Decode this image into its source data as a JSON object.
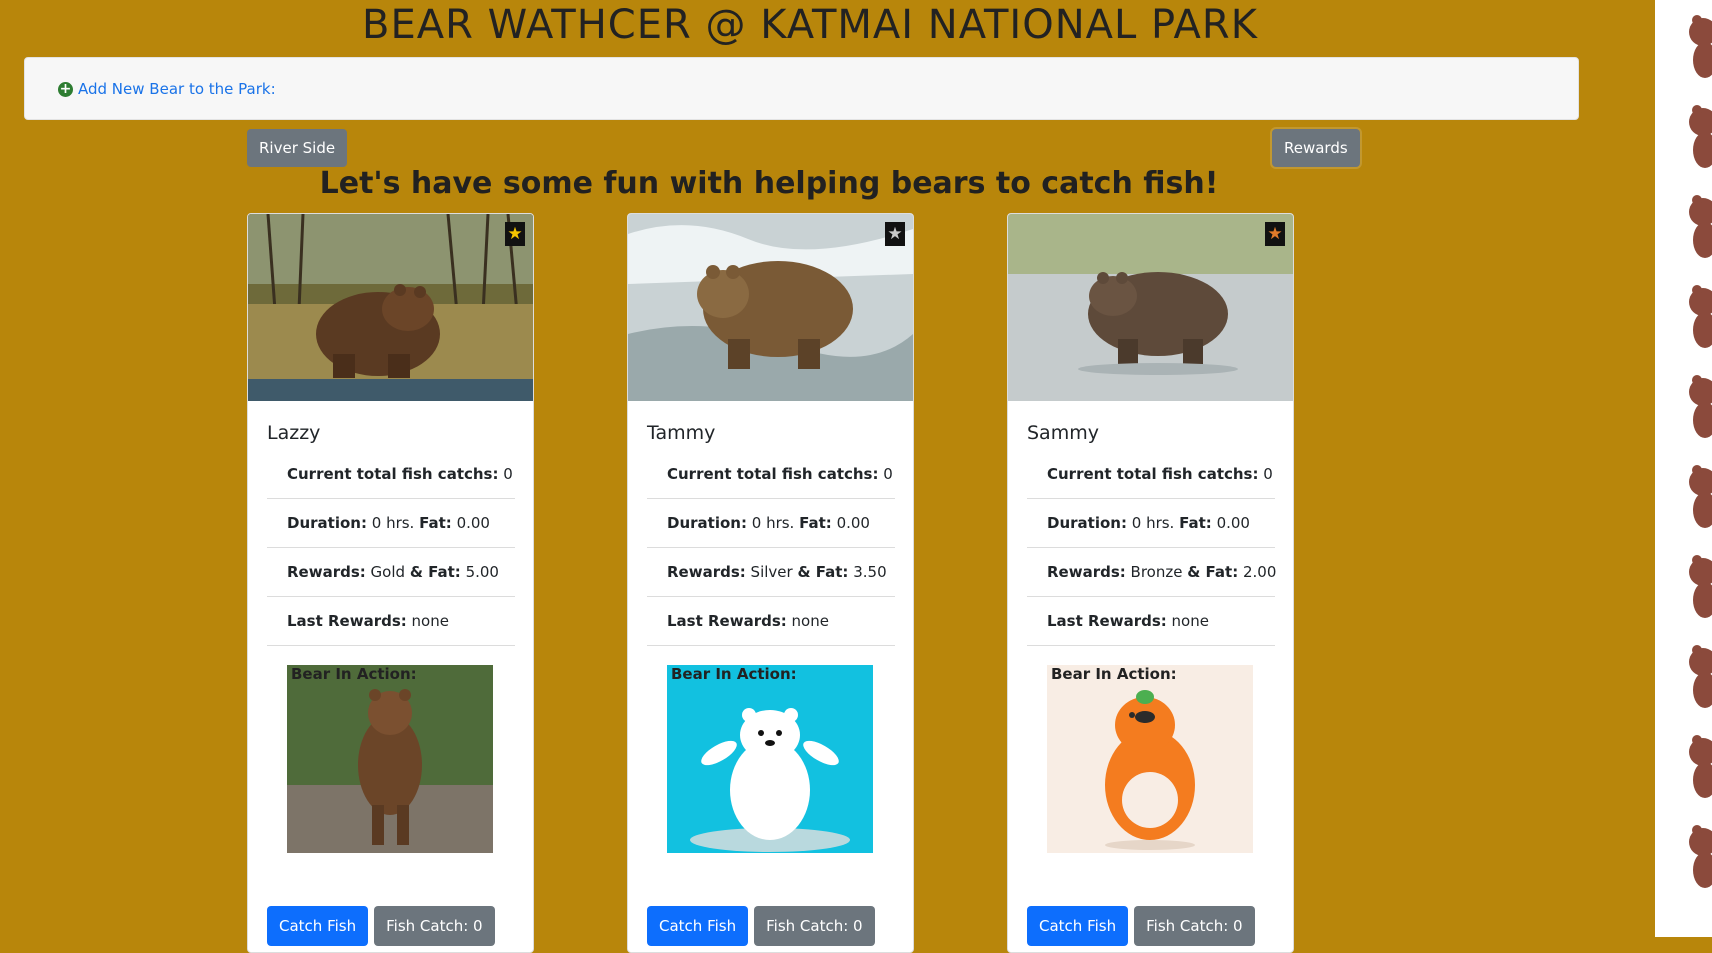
{
  "page": {
    "title": "BEAR WATHCER @ KATMAI NATIONAL PARK",
    "add_bear_label": "Add New Bear to the Park:",
    "river_side_label": "River Side",
    "rewards_label": "Rewards",
    "heading": "Let's have some fun with helping bears to catch fish!"
  },
  "labels": {
    "total_catch": "Current total fish catchs:",
    "duration": "Duration:",
    "hrs": "hrs.",
    "fat": "Fat:",
    "rewards": "Rewards:",
    "and_fat": "& Fat:",
    "last_rewards": "Last Rewards:",
    "bear_in_action": "Bear In Action:",
    "catch_fish": "Catch Fish",
    "fish_catch": "Fish Catch: 0"
  },
  "bears": [
    {
      "name": "Lazzy",
      "total_catch": "0",
      "duration": "0",
      "fat": "0.00",
      "reward": "Gold",
      "reward_fat": "5.00",
      "last_rewards": "none",
      "star_color": "#f5c400",
      "star_icon": "gold-star-icon"
    },
    {
      "name": "Tammy",
      "total_catch": "0",
      "duration": "0",
      "fat": "0.00",
      "reward": "Silver",
      "reward_fat": "3.50",
      "last_rewards": "none",
      "star_color": "#c8c8c8",
      "star_icon": "silver-star-icon"
    },
    {
      "name": "Sammy",
      "total_catch": "0",
      "duration": "0",
      "fat": "0.00",
      "reward": "Bronze",
      "reward_fat": "2.00",
      "last_rewards": "none",
      "star_color": "#e07a2a",
      "star_icon": "bronze-star-icon"
    }
  ],
  "colors": {
    "background": "#b8860b",
    "primary": "#0d6efd",
    "secondary": "#6c757d",
    "add_icon": "#2e7d32",
    "link": "#1a73e8"
  }
}
